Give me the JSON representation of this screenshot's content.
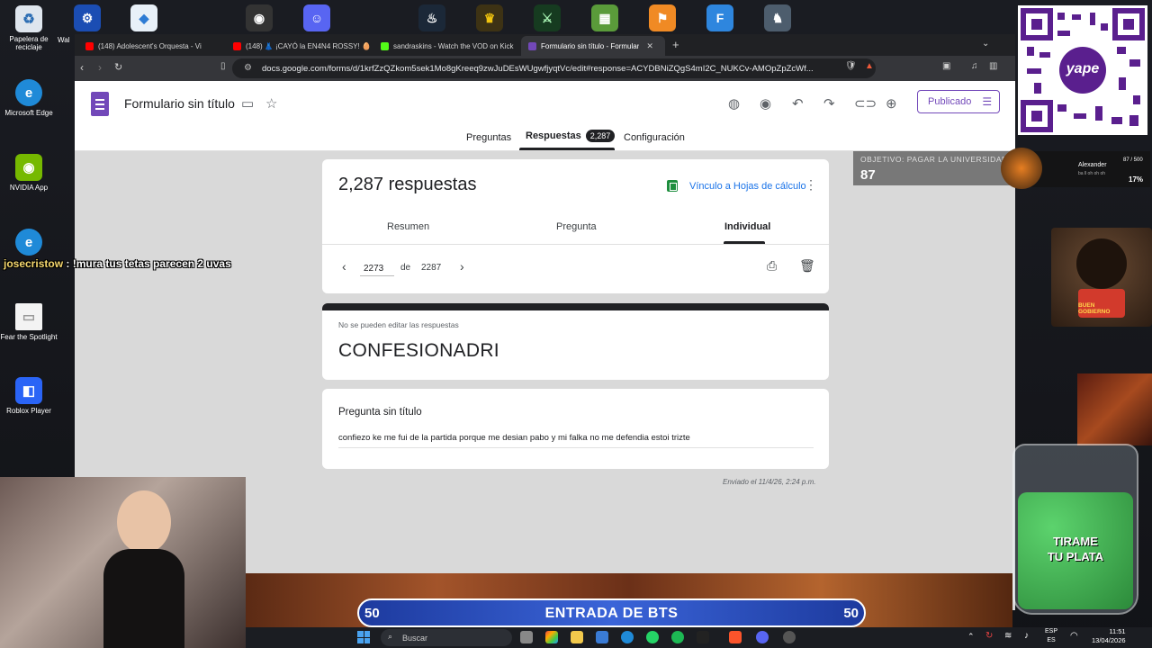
{
  "desktop": {
    "icons": [
      {
        "label": "Papelera de reciclaje",
        "icon": "recycle-bin-icon"
      },
      {
        "label": "Microsoft Edge",
        "icon": "edge-icon"
      },
      {
        "label": "NVIDIA App",
        "icon": "nvidia-icon"
      },
      {
        "label": "Fear the Spotlight",
        "icon": "file-icon"
      },
      {
        "label": "Roblox Player",
        "icon": "roblox-icon"
      }
    ],
    "partial_label": "Wal"
  },
  "browser": {
    "tabs": [
      {
        "label": "(148) Adolescent's Orquesta - Vi",
        "color": "#ff0000",
        "active": false
      },
      {
        "label": "(148) 👗 ¡CAYÓ la EN4N4 ROSSY! 🥚",
        "color": "#ff0000",
        "active": false
      },
      {
        "label": "sandraskins - Watch the VOD on Kick",
        "color": "#53fc18",
        "active": false
      },
      {
        "label": "Formulario sin título - Formular",
        "color": "#7248b9",
        "active": true
      }
    ],
    "new_tab": "+",
    "url": "docs.google.com/forms/d/1krfZzQZkom5sek1Mo8gKreeq9zwJuDEsWUgwfjyqtVc/edit#response=ACYDBNiZQgS4mI2C_NUKCv-AMOpZpZcWf..."
  },
  "form": {
    "title": "Formulario sin título",
    "publish_label": "Publicado",
    "tabs": {
      "questions": "Preguntas",
      "responses": "Respuestas",
      "settings": "Configuración"
    },
    "responses_badge": "2,287",
    "responses_count_text": "2,287 respuestas",
    "sheets_link": "Vínculo a Hojas de cálculo",
    "subtabs": {
      "summary": "Resumen",
      "question": "Pregunta",
      "individual": "Individual"
    },
    "pager": {
      "current": "2273",
      "of": "de",
      "total": "2287"
    },
    "cannot_edit": "No se pueden editar las respuestas",
    "form_heading": "CONFESIONADRI",
    "question_title": "Pregunta sin título",
    "answer": "confiezo ke me fui de la partida porque me desian pabo y mi falka no me defendia estoi trizte",
    "sent_at": "Enviado el 11/4/26, 2:24 p.m."
  },
  "overlay": {
    "chat_user": "josecristow",
    "chat_message": " : !mura tus tetas parecen 2 uvas",
    "goal_title": "OBJETIVO: PAGAR LA UNIVERSIDAD",
    "goal_value": "87",
    "music_artist": "Alexander",
    "music_sub": "ba ll oh oh oh",
    "music_progress": "87 / 500",
    "music_percent": "17%",
    "qr_brand": "yape",
    "bts_left": "50",
    "bts_center": "ENTRADA DE BTS",
    "bts_right": "50",
    "jar_text_1": "TIRAME",
    "jar_text_2": "TU PLATA",
    "dog_sign": "BUEN GOBIERNO"
  },
  "taskbar": {
    "search_placeholder": "Buscar",
    "lang_1": "ESP",
    "lang_2": "ES",
    "time": "11:51",
    "date": "13/04/2026"
  }
}
